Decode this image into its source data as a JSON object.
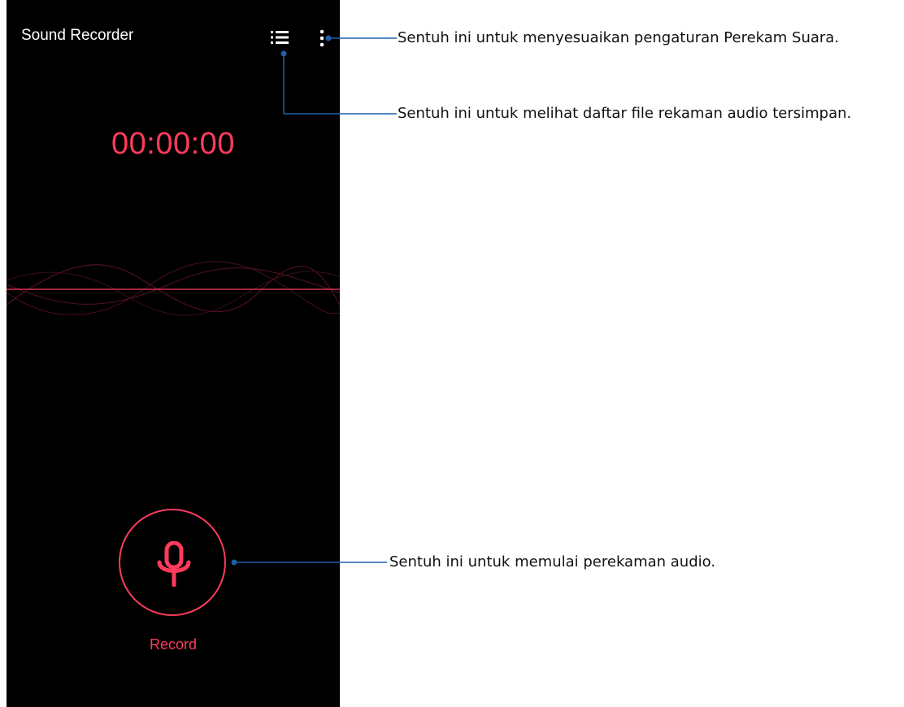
{
  "app": {
    "title": "Sound Recorder"
  },
  "toolbar": {
    "list_icon": "list-icon",
    "more_icon": "more-vertical-icon"
  },
  "timer": {
    "value": "00:00:00"
  },
  "record": {
    "label": "Record",
    "icon": "microphone-icon"
  },
  "callouts": {
    "settings": "Sentuh ini untuk menyesuaikan pengaturan Perekam Suara.",
    "list": "Sentuh ini untuk melihat daftar file rekaman audio tersimpan.",
    "record": "Sentuh ini untuk memulai perekaman audio."
  },
  "colors": {
    "accent": "#ff3b5c",
    "background": "#000000",
    "leader": "#1f5fa8"
  }
}
